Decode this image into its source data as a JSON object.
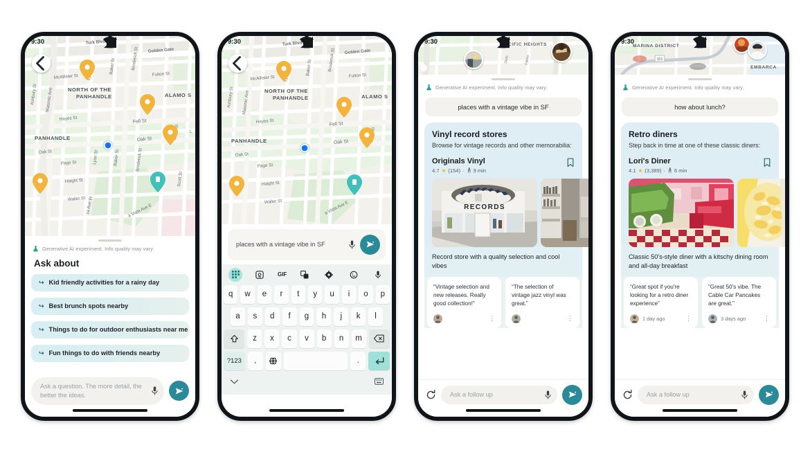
{
  "status": {
    "time": "9:30",
    "icons": [
      "wifi-icon",
      "signal-icon",
      "battery-icon"
    ]
  },
  "common": {
    "disclaimer": "Generative AI experiment. Info quality may vary.",
    "lab_icon": "lab-flask-icon",
    "mic_icon": "microphone-icon",
    "send_icon": "send-icon",
    "refresh_icon": "refresh-icon",
    "bookmark_icon": "bookmark-icon",
    "back_icon": "back-arrow-icon",
    "accent": "#2b8a98",
    "card_blue": "#dfeef4",
    "chip_gradient_start": "#d7eef2",
    "chip_gradient_end": "#e6f1ec",
    "star_color": "#f0b323"
  },
  "phone1": {
    "map": {
      "labels": [
        "Turk Blvd",
        "Golden Gate",
        "McAllister St",
        "Fulton St",
        "NORTH OF THE PANHANDLE",
        "ALAMO S",
        "Hayes St",
        "Fell St",
        "PANHANDLE",
        "Oak St",
        "Oak St",
        "Page St",
        "Haight St",
        "Waller St",
        "Masonic Ave",
        "Lyon St",
        "Lyon St",
        "Baker St",
        "Baker St",
        "Broderick St",
        "Broderick St",
        "Scott St",
        "Scott St",
        "Ashbury St",
        "Buena Vista Ave E",
        "Buena Ave W",
        "L"
      ],
      "pins": 4,
      "user_location": "blue-location-dot"
    },
    "ask_title": "Ask about",
    "suggestions": [
      "Kid friendly activities for a rainy day",
      "Best brunch spots nearby",
      "Things to do for outdoor enthusiasts near me",
      "Fun things to do with friends nearby"
    ],
    "input_placeholder": "Ask a question. The more detail, the better the ideas."
  },
  "phone2": {
    "map": {
      "labels": [
        "Turk Blvd",
        "Golden Gate",
        "McAllister St",
        "Fulton St",
        "NORTH OF THE PANHANDLE",
        "ALAMO S",
        "Hayes St",
        "Fell St",
        "PANHANDLE",
        "Oak St",
        "Oak St",
        "Page St",
        "Haight St",
        "Waller St",
        "Masonic Ave",
        "Lyon St",
        "Baker St",
        "Broderick St",
        "Scott St",
        "Ashbury St",
        "Buena Vista Ave E"
      ]
    },
    "input_value": "places with a vintage vibe in SF",
    "keyboard": {
      "toolbar": [
        "apps-grid-icon",
        "sticker-icon",
        "gif-icon",
        "translate-icon",
        "settings-gear-icon",
        "emoji-icon",
        "microphone-icon"
      ],
      "gif_label": "GIF",
      "row1": [
        "q",
        "w",
        "e",
        "r",
        "t",
        "y",
        "u",
        "i",
        "o",
        "p"
      ],
      "row2": [
        "a",
        "s",
        "d",
        "f",
        "g",
        "h",
        "j",
        "k",
        "l"
      ],
      "row3": [
        "z",
        "x",
        "c",
        "v",
        "b",
        "n",
        "m"
      ],
      "shift_icon": "shift-icon",
      "backspace_icon": "backspace-icon",
      "num_key": "?123",
      "comma_key": ",",
      "globe_icon": "globe-icon",
      "period_key": ".",
      "enter_icon": "enter-icon",
      "collapse_icon": "chevron-down-icon",
      "keyboard_switch_icon": "keyboard-icon"
    }
  },
  "phone3": {
    "map": {
      "labels": [
        "PACIFIC HEIGHTS",
        "Divis",
        "Fillmore"
      ]
    },
    "query": "places with a vintage vibe in SF",
    "answer": {
      "title": "Vinyl record stores",
      "subtitle": "Browse for vintage records and other memorabilia:"
    },
    "place": {
      "name": "Originals Vinyl",
      "rating": "4.7",
      "reviews_count": "(154)",
      "separator": "·",
      "walk_time": "9 min",
      "walk_icon": "walking-icon",
      "photos": [
        "record-store-front-photo",
        "record-store-interior-photo"
      ],
      "photo_sign": "RECORDS",
      "description": "Record store with a quality selection and cool vibes",
      "reviews": [
        {
          "text": "“Vintage selection and new releases. Really good collection!”",
          "when": "",
          "avatar": "reviewer-avatar"
        },
        {
          "text": "“The selection of vintage jazz vinyl was great.”",
          "when": "",
          "avatar": "reviewer-avatar"
        }
      ]
    },
    "followup_placeholder": "Ask a follow up"
  },
  "phone4": {
    "map": {
      "labels": [
        "MARINA DISTRICT",
        "EMBARCA",
        "101"
      ]
    },
    "query": "how about lunch?",
    "answer": {
      "title": "Retro diners",
      "subtitle": "Step back in time at one of these classic diners:"
    },
    "place": {
      "name": "Lori's Diner",
      "rating": "4.1",
      "reviews_count": "(3,389)",
      "separator": "·",
      "walk_time": "6 min",
      "walk_icon": "walking-icon",
      "photos": [
        "diner-interior-photo",
        "diner-food-photo"
      ],
      "description": "Classic 50's-style diner with a kitschy dining room and all-day breakfast",
      "reviews": [
        {
          "text": "“Great spot if you're looking for a retro diner experience”",
          "when": "1 day ago",
          "avatar": "reviewer-avatar"
        },
        {
          "text": "“Great 50's vibe. The Cable Car Pancakes are great.”",
          "when": "3 days ago",
          "avatar": "reviewer-avatar"
        }
      ]
    },
    "followup_placeholder": "Ask a follow up"
  }
}
